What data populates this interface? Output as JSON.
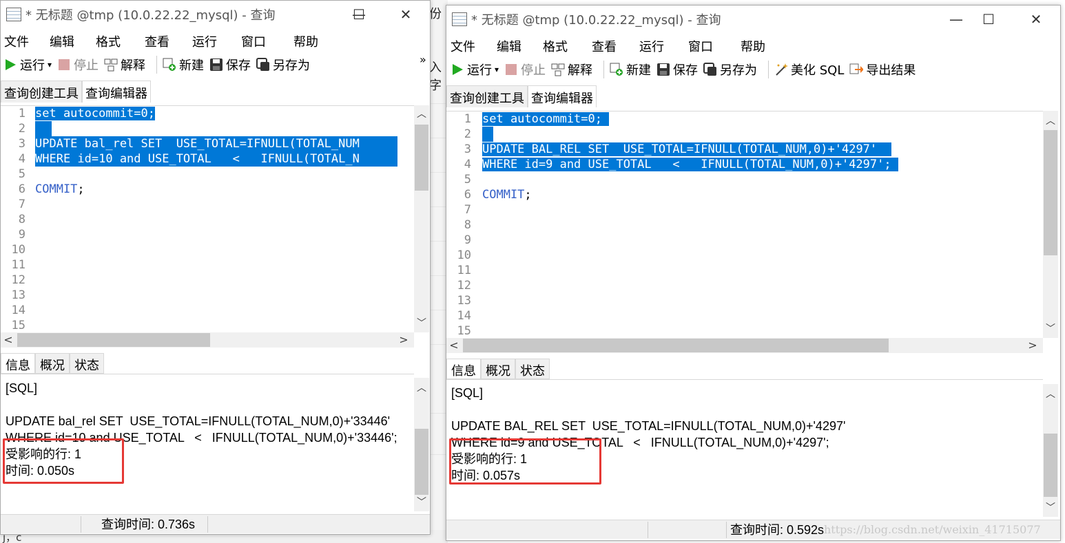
{
  "backdrop": {
    "frag1": "份",
    "frag2": "入字",
    "frag3": "j，c"
  },
  "window1": {
    "title": "* 无标题 @tmp (10.0.22.22_mysql) - 查询",
    "menu": [
      "文件",
      "编辑",
      "格式",
      "查看",
      "运行",
      "窗口",
      "帮助"
    ],
    "toolbar": {
      "run": "运行",
      "stop": "停止",
      "explain": "解释",
      "new": "新建",
      "save": "保存",
      "save_as": "另存为",
      "overflow": "»"
    },
    "tabs": [
      "查询创建工具",
      "查询编辑器"
    ],
    "line_numbers": [
      "1",
      "2",
      "3",
      "4",
      "5",
      "6",
      "7",
      "8",
      "9",
      "10",
      "11",
      "12",
      "13",
      "14",
      "15"
    ],
    "code": {
      "l1": "set autocommit=0;",
      "l3": "UPDATE bal_rel SET  USE_TOTAL=IFNULL(TOTAL_NUM",
      "l4": "WHERE id=10 and USE_TOTAL   <   IFNULL(TOTAL_N",
      "l6a": "COMMIT",
      "l6b": ";"
    },
    "info_tabs": [
      "信息",
      "概况",
      "状态"
    ],
    "info": {
      "l1": "[SQL]",
      "l2": "UPDATE bal_rel SET  USE_TOTAL=IFNULL(TOTAL_NUM,0)+'33446'",
      "l3": "WHERE id=10 and USE_TOTAL   <   IFNULL(TOTAL_NUM,0)+'33446';",
      "l4": "受影响的行: 1",
      "l5": "时间: 0.050s"
    },
    "status": "查询时间: 0.736s"
  },
  "window2": {
    "title": "* 无标题 @tmp (10.0.22.22_mysql) - 查询",
    "menu": [
      "文件",
      "编辑",
      "格式",
      "查看",
      "运行",
      "窗口",
      "帮助"
    ],
    "toolbar": {
      "run": "运行",
      "stop": "停止",
      "explain": "解释",
      "new": "新建",
      "save": "保存",
      "save_as": "另存为",
      "beautify": "美化 SQL",
      "export": "导出结果"
    },
    "tabs": [
      "查询创建工具",
      "查询编辑器"
    ],
    "line_numbers": [
      "1",
      "2",
      "3",
      "4",
      "5",
      "6",
      "7",
      "8",
      "9",
      "10",
      "11",
      "12",
      "13",
      "14",
      "15"
    ],
    "code": {
      "l1": "set autocommit=0;",
      "l3": "UPDATE BAL_REL SET  USE_TOTAL=IFNULL(TOTAL_NUM,0)+'4297'",
      "l4": "WHERE id=9 and USE_TOTAL   <   IFNULL(TOTAL_NUM,0)+'4297';",
      "l6a": "COMMIT",
      "l6b": ";"
    },
    "info_tabs": [
      "信息",
      "概况",
      "状态"
    ],
    "info": {
      "l1": "[SQL]",
      "l2": "UPDATE BAL_REL SET  USE_TOTAL=IFNULL(TOTAL_NUM,0)+'4297'",
      "l3": "WHERE id=9 and USE_TOTAL   <   IFNULL(TOTAL_NUM,0)+'4297';",
      "l4": "受影响的行: 1",
      "l5": "时间: 0.057s"
    },
    "status": "查询时间: 0.592s"
  },
  "watermark": "https://blog.csdn.net/weixin_41715077",
  "colors": {
    "selection": "#0078d7",
    "keyword": "#3560c8",
    "highlight_box": "#e53935",
    "run_icon": "#22aa22"
  }
}
